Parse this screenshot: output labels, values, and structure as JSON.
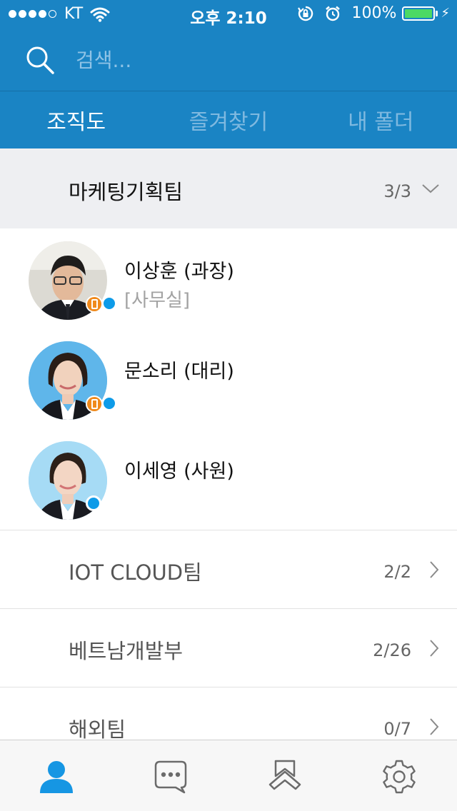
{
  "status_bar": {
    "carrier": "KT",
    "time": "오후 2:10",
    "battery": "100%",
    "battery_level": 1.0
  },
  "search": {
    "placeholder": "검색..."
  },
  "tabs": [
    {
      "label": "조직도",
      "active": true
    },
    {
      "label": "즐겨찾기",
      "active": false
    },
    {
      "label": "내 폴더",
      "active": false
    }
  ],
  "expanded_group": {
    "name": "마케팅기획팀",
    "count": "3/3",
    "members": [
      {
        "name": "이상훈 (과장)",
        "status": "[사무실]",
        "mobile": true,
        "online": true
      },
      {
        "name": "문소리 (대리)",
        "status": "",
        "mobile": true,
        "online": true
      },
      {
        "name": "이세영 (사원)",
        "status": "",
        "mobile": false,
        "online": true
      }
    ]
  },
  "groups": [
    {
      "name": "IOT CLOUD팀",
      "count": "2/2"
    },
    {
      "name": "베트남개발부",
      "count": "2/26"
    },
    {
      "name": "해외팀",
      "count": "0/7"
    }
  ],
  "tabbar": [
    {
      "icon": "person-icon",
      "active": true
    },
    {
      "icon": "chat-bubble-icon",
      "active": false
    },
    {
      "icon": "bookmark-icon",
      "active": false
    },
    {
      "icon": "gear-icon",
      "active": false
    }
  ],
  "colors": {
    "header": "#1a84c4",
    "accent": "#0e9be8",
    "presence": "#0e9be8",
    "mobile_badge": "#f08a1c",
    "battery_fill": "#4cd964"
  }
}
